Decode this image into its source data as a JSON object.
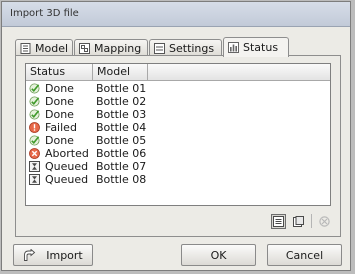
{
  "window": {
    "title": "Import 3D file"
  },
  "tabs": [
    {
      "label": "Model",
      "icon": "model-icon",
      "active": false
    },
    {
      "label": "Mapping",
      "icon": "mapping-icon",
      "active": false
    },
    {
      "label": "Settings",
      "icon": "settings-icon",
      "active": false
    },
    {
      "label": "Status",
      "icon": "status-chart-icon",
      "active": true
    }
  ],
  "table": {
    "columns": [
      "Status",
      "Model"
    ],
    "rows": [
      {
        "status": "Done",
        "icon": "check-icon",
        "model": "Bottle 01"
      },
      {
        "status": "Done",
        "icon": "check-icon",
        "model": "Bottle 02"
      },
      {
        "status": "Done",
        "icon": "check-icon",
        "model": "Bottle 03"
      },
      {
        "status": "Failed",
        "icon": "error-icon",
        "model": "Bottle 04"
      },
      {
        "status": "Done",
        "icon": "check-icon",
        "model": "Bottle 05"
      },
      {
        "status": "Aborted",
        "icon": "aborted-icon",
        "model": "Bottle 06"
      },
      {
        "status": "Queued",
        "icon": "hourglass-icon",
        "model": "Bottle 07"
      },
      {
        "status": "Queued",
        "icon": "hourglass-icon",
        "model": "Bottle 08"
      }
    ]
  },
  "toolbar": {
    "buttons": [
      "list-view-icon",
      "report-icon",
      "clear-icon"
    ]
  },
  "buttons": {
    "import": "Import",
    "ok": "OK",
    "cancel": "Cancel"
  },
  "colors": {
    "done": "#3f9a2a",
    "failed": "#d24b2c",
    "aborted": "#d24b2c",
    "queued": "#4a4a4a"
  }
}
